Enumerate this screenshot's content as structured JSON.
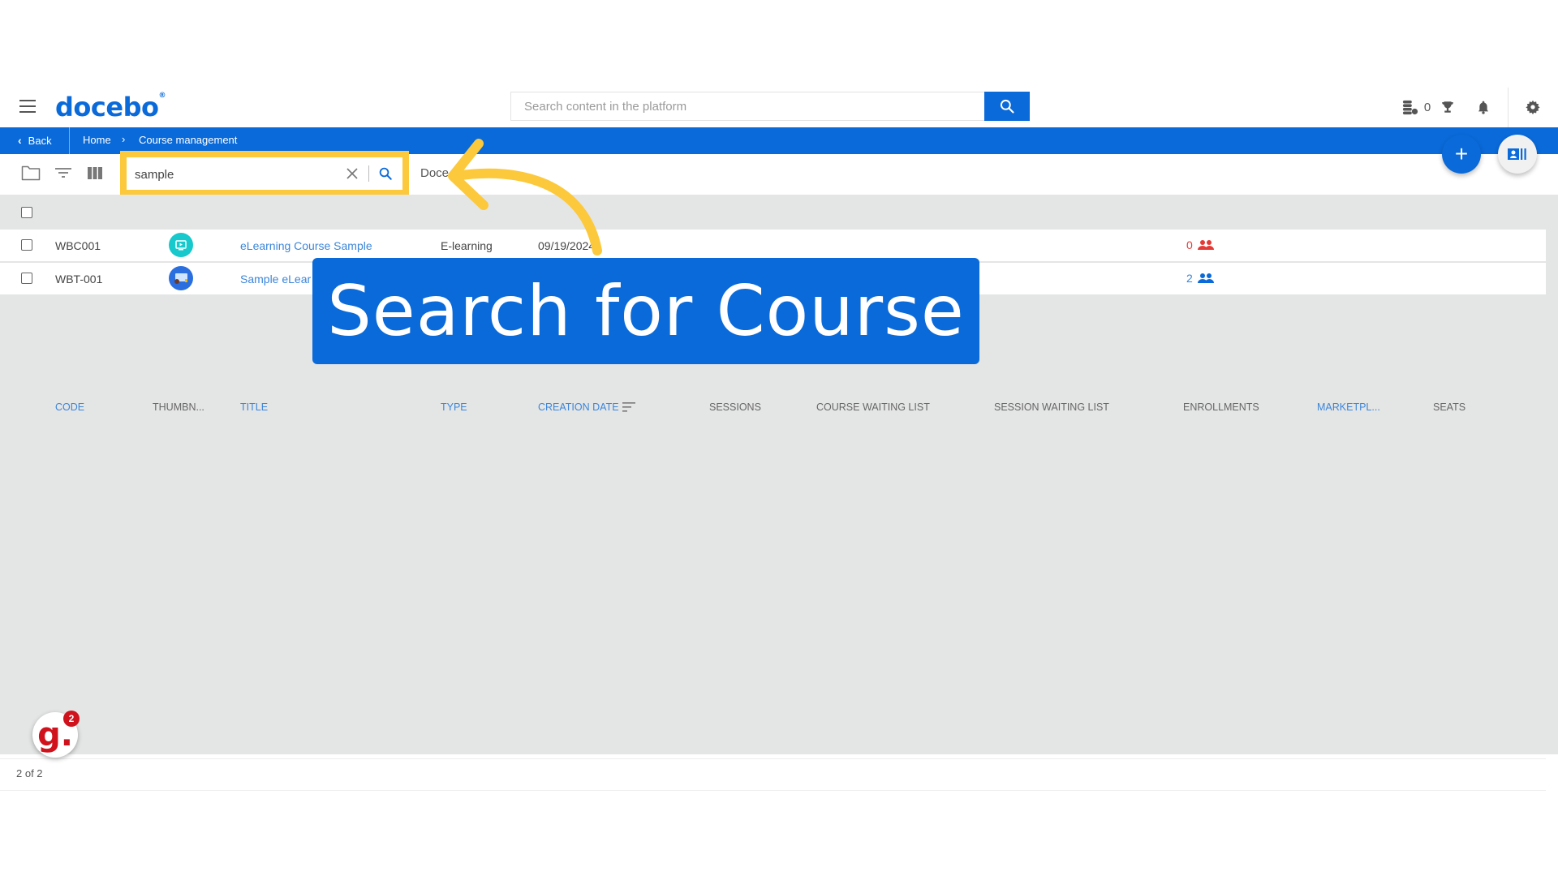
{
  "header": {
    "logo": "docebo",
    "logo_mark": "®",
    "search_placeholder": "Search content in the platform",
    "credits_count": "0",
    "icons": [
      "menu-icon",
      "search-icon",
      "credits-icon",
      "trophy-icon",
      "bell-icon",
      "gear-icon"
    ]
  },
  "breadcrumb": {
    "back_label": "Back",
    "items": [
      "Home",
      "Course management"
    ]
  },
  "toolbar": {
    "filter_search_value": "sample",
    "next_label": "Doce",
    "icons": [
      "folder-icon",
      "filter-icon",
      "columns-icon",
      "clear-icon",
      "search-icon"
    ]
  },
  "fabs": {
    "add_label": "+"
  },
  "table": {
    "columns": [
      "CODE",
      "THUMBN...",
      "TITLE",
      "TYPE",
      "CREATION DATE",
      "SESSIONS",
      "COURSE WAITING LIST",
      "SESSION WAITING LIST",
      "ENROLLMENTS",
      "MARKETPL...",
      "SEATS"
    ],
    "rows": [
      {
        "code": "WBC001",
        "title": "eLearning Course Sample",
        "type": "E-learning",
        "creation_date": "09/19/2024",
        "sessions": "",
        "course_waiting_list": "",
        "session_waiting_list": "",
        "enrollments": "0",
        "enrollments_color": "#e53935",
        "marketplace": "",
        "seats": ""
      },
      {
        "code": "WBT-001",
        "title": "Sample eLear",
        "type": "",
        "creation_date": "",
        "sessions": "",
        "course_waiting_list": "",
        "session_waiting_list": "",
        "enrollments": "2",
        "enrollments_color": "#3c86d9",
        "marketplace": "",
        "seats": ""
      }
    ]
  },
  "footer": {
    "pagination": "2 of 2"
  },
  "guide_widget": {
    "letter": "g.",
    "badge": "2"
  },
  "callout": {
    "text": "Search for Course"
  },
  "colors": {
    "brand": "#0a6ad9",
    "highlight": "#fcc93c",
    "content_bg": "#e4e5e5"
  }
}
